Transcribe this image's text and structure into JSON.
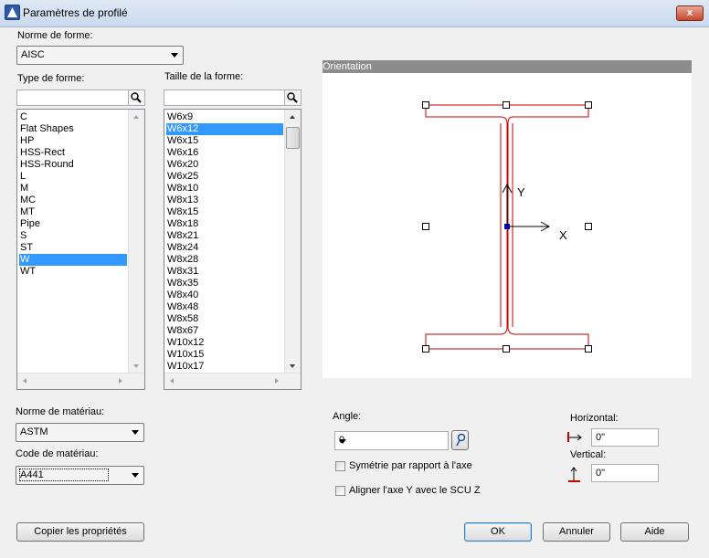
{
  "window": {
    "title": "Paramètres de profilé",
    "close_label": "x"
  },
  "shape_standard": {
    "label": "Norme de forme:",
    "value": "AISC"
  },
  "shape_type": {
    "label": "Type de forme:",
    "items": [
      "C",
      "Flat Shapes",
      "HP",
      "HSS-Rect",
      "HSS-Round",
      "L",
      "M",
      "MC",
      "MT",
      "Pipe",
      "S",
      "ST",
      "W",
      "WT"
    ],
    "selected": "W"
  },
  "shape_size": {
    "label": "Taille de la forme:",
    "items": [
      "W6x9",
      "W6x12",
      "W6x15",
      "W6x16",
      "W6x20",
      "W6x25",
      "W8x10",
      "W8x13",
      "W8x15",
      "W8x18",
      "W8x21",
      "W8x24",
      "W8x28",
      "W8x31",
      "W8x35",
      "W8x40",
      "W8x48",
      "W8x58",
      "W8x67",
      "W10x12",
      "W10x15",
      "W10x17"
    ],
    "selected": "W6x12"
  },
  "orientation": {
    "label": "Orientation",
    "axis_y": "Y",
    "axis_x": "X"
  },
  "material_standard": {
    "label": "Norme de matériau:",
    "value": "ASTM"
  },
  "material_code": {
    "label": "Code de matériau:",
    "value": "A441"
  },
  "angle": {
    "label": "Angle:",
    "value": "0"
  },
  "mirror": {
    "label": "Symétrie par rapport à l'axe",
    "checked": false
  },
  "align_ucs": {
    "label": "Aligner l'axe Y avec le SCU Z",
    "checked": false
  },
  "horizontal": {
    "label": "Horizontal:",
    "value": "0\""
  },
  "vertical": {
    "label": "Vertical:",
    "value": "0\""
  },
  "buttons": {
    "copy": "Copier les propriétés",
    "ok": "OK",
    "cancel": "Annuler",
    "help": "Aide"
  },
  "colors": {
    "selection": "#3399ff",
    "profile": "#cc0000",
    "panel_header": "#8c8c8c"
  }
}
